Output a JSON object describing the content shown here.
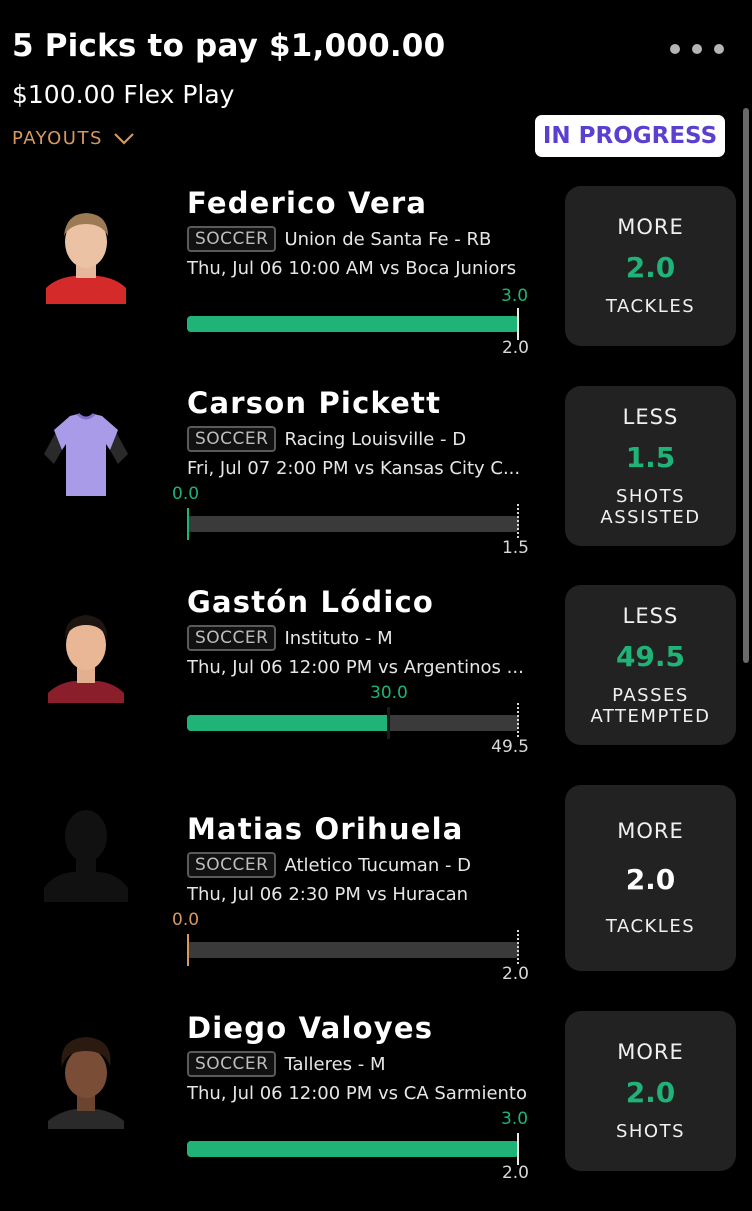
{
  "header": {
    "title": "5 Picks to pay $1,000.00",
    "subtitle": "$100.00 Flex Play",
    "payouts_label": "PAYOUTS",
    "status": "IN PROGRESS"
  },
  "colors": {
    "accent_green": "#1fb377",
    "accent_orange": "#d79a5e",
    "badge_text": "#5b3fd1"
  },
  "picks": [
    {
      "name": "Federico Vera",
      "sport": "SOCCER",
      "team": "Union de Santa Fe - RB",
      "game": "Thu, Jul 06 10:00 AM  vs Boca Juniors",
      "current": "3.0",
      "line": "2.0",
      "progress": 1.0,
      "direction": "MORE",
      "value": "2.0",
      "stat": "TACKLES"
    },
    {
      "name": "Carson Pickett",
      "sport": "SOCCER",
      "team": "Racing Louisville - D",
      "game": "Fri, Jul 07 2:00 PM  vs Kansas City C...",
      "current": "0.0",
      "line": "1.5",
      "progress": 0.0,
      "direction": "LESS",
      "value": "1.5",
      "stat": "SHOTS\nASSISTED"
    },
    {
      "name": "Gastón Lódico",
      "sport": "SOCCER",
      "team": "Instituto - M",
      "game": "Thu, Jul 06 12:00 PM  vs Argentinos ...",
      "current": "30.0",
      "line": "49.5",
      "progress": 0.606,
      "direction": "LESS",
      "value": "49.5",
      "stat": "PASSES\nATTEMPTED"
    },
    {
      "name": "Matias Orihuela",
      "sport": "SOCCER",
      "team": "Atletico Tucuman - D",
      "game": "Thu, Jul 06 2:30 PM  vs Huracan",
      "current": "0.0",
      "line": "2.0",
      "progress": 0.0,
      "direction": "MORE",
      "value": "2.0",
      "stat": "TACKLES"
    },
    {
      "name": "Diego Valoyes",
      "sport": "SOCCER",
      "team": "Talleres - M",
      "game": "Thu, Jul 06 12:00 PM  vs CA Sarmiento",
      "current": "3.0",
      "line": "2.0",
      "progress": 1.0,
      "direction": "MORE",
      "value": "2.0",
      "stat": "SHOTS"
    }
  ]
}
